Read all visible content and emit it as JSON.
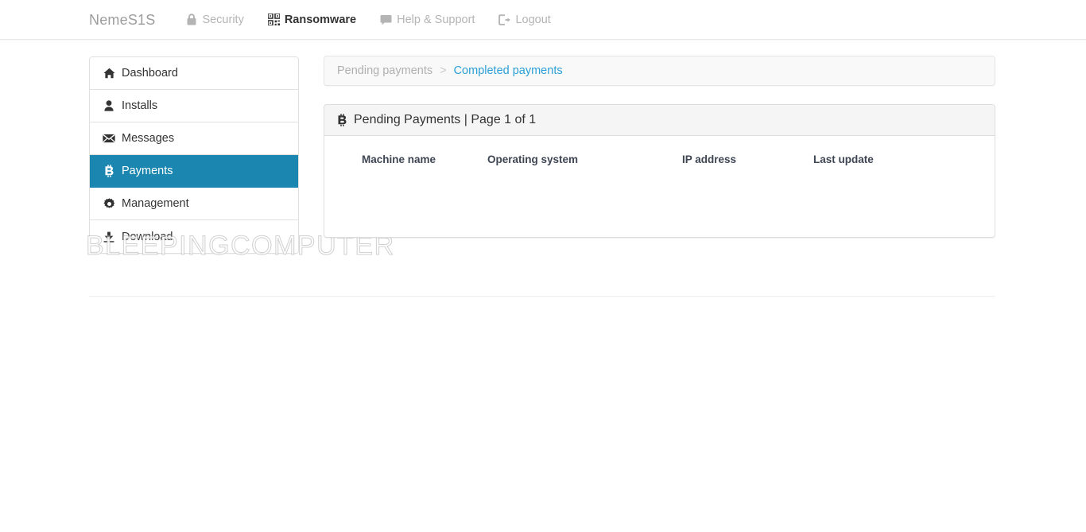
{
  "navbar": {
    "brand": "NemeS1S",
    "items": [
      {
        "label": "Security",
        "icon": "lock-icon",
        "active": false
      },
      {
        "label": "Ransomware",
        "icon": "qrcode-icon",
        "active": true
      },
      {
        "label": "Help & Support",
        "icon": "comment-icon",
        "active": false
      },
      {
        "label": "Logout",
        "icon": "sign-out-icon",
        "active": false
      }
    ]
  },
  "sidebar": {
    "items": [
      {
        "label": "Dashboard",
        "icon": "home-icon",
        "active": false
      },
      {
        "label": "Installs",
        "icon": "user-icon",
        "active": false
      },
      {
        "label": "Messages",
        "icon": "envelope-icon",
        "active": false
      },
      {
        "label": "Payments",
        "icon": "bitcoin-icon",
        "active": true
      },
      {
        "label": "Management",
        "icon": "gear-icon",
        "active": false
      },
      {
        "label": "Download",
        "icon": "download-icon",
        "active": false
      }
    ]
  },
  "breadcrumb": {
    "current": "Pending payments",
    "separator": ">",
    "link": "Completed payments"
  },
  "panel": {
    "title": "Pending Payments | Page 1 of 1",
    "icon": "bitcoin-icon",
    "columns": [
      "Machine name",
      "Operating system",
      "IP address",
      "Last update"
    ],
    "rows": []
  },
  "watermark": "BLEEPINGCOMPUTER",
  "colors": {
    "accent": "#1b87b0",
    "link": "#2a9fd6",
    "nav_muted": "#b4b4b4",
    "panel_header_bg": "#f5f5f5",
    "breadcrumb_bg": "#f9f9f9"
  }
}
